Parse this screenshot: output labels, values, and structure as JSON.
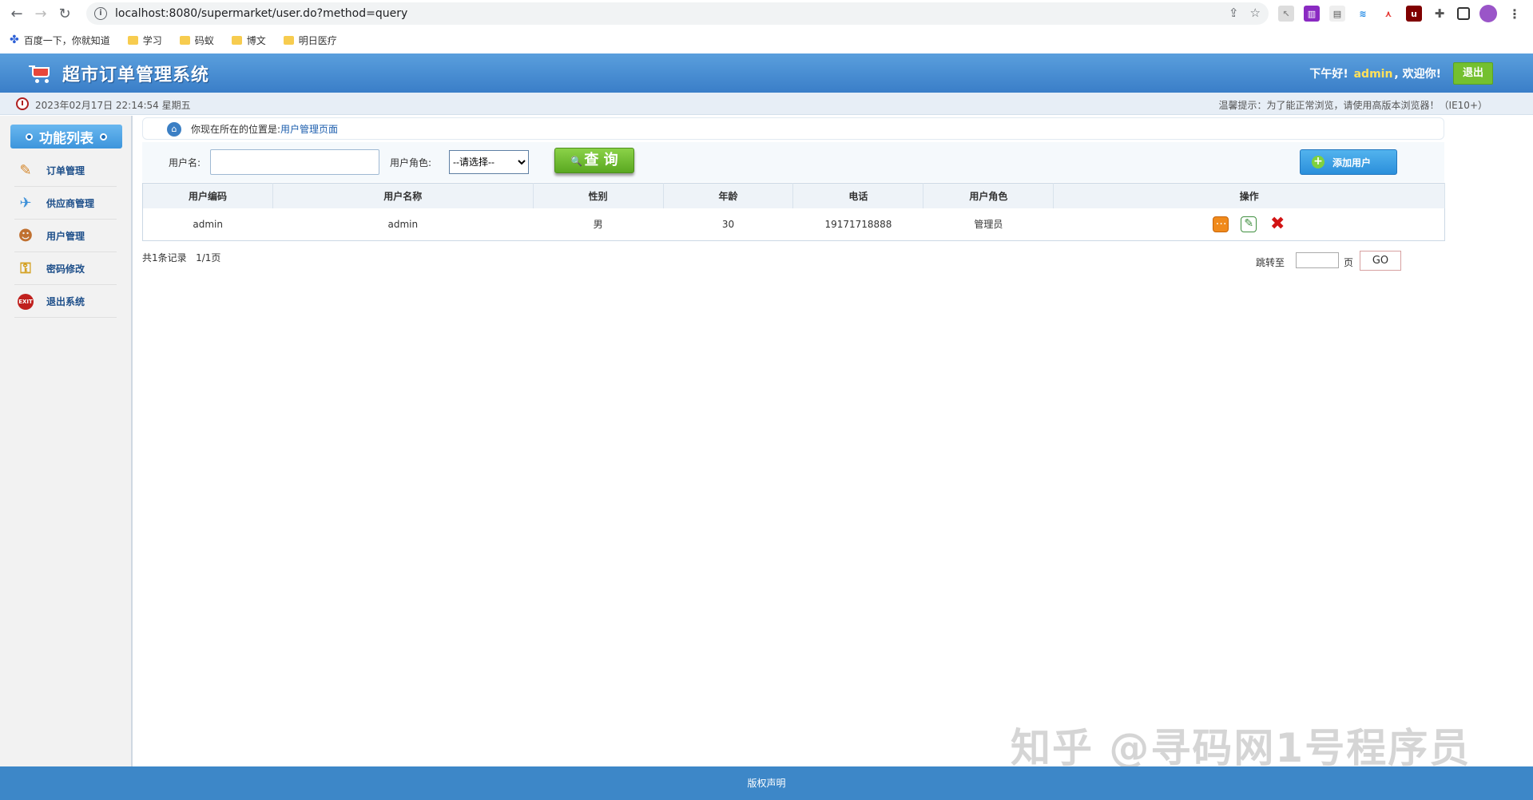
{
  "browser": {
    "url": "localhost:8080/supermarket/user.do?method=query",
    "bookmarks": [
      "百度一下，你就知道",
      "学习",
      "码蚁",
      "博文",
      "明日医疗"
    ]
  },
  "header": {
    "title": "超市订单管理系统",
    "greeting_prefix": "下午好!",
    "username": "admin",
    "greeting_suffix": ", 欢迎你!",
    "logout_label": "退出"
  },
  "info_bar": {
    "datetime": "2023年02月17日 22:14:54 星期五",
    "tip": "温馨提示：为了能正常浏览，请使用高版本浏览器！（IE10+）"
  },
  "sidebar": {
    "title": "功能列表",
    "items": [
      {
        "label": "订单管理",
        "icon": "order-icon"
      },
      {
        "label": "供应商管理",
        "icon": "supplier-icon"
      },
      {
        "label": "用户管理",
        "icon": "users-icon"
      },
      {
        "label": "密码修改",
        "icon": "password-icon"
      },
      {
        "label": "退出系统",
        "icon": "exit-icon"
      }
    ]
  },
  "breadcrumb": {
    "prefix": "你现在所在的位置是:",
    "current": "用户管理页面"
  },
  "search": {
    "username_label": "用户名:",
    "username_value": "",
    "role_label": "用户角色:",
    "role_selected": "--请选择--",
    "query_label": "查 询",
    "add_label": "添加用户"
  },
  "table": {
    "headers": [
      "用户编码",
      "用户名称",
      "性别",
      "年龄",
      "电话",
      "用户角色",
      "操作"
    ],
    "rows": [
      {
        "code": "admin",
        "name": "admin",
        "gender": "男",
        "age": "30",
        "phone": "19171718888",
        "role": "管理员"
      }
    ]
  },
  "pagination": {
    "record_count": "共1条记录",
    "page_info": "1/1页",
    "jump_label": "跳转至",
    "page_unit": "页",
    "go_label": "GO"
  },
  "footer": {
    "copyright": "版权声明"
  },
  "watermark": "知乎 @寻码网1号程序员",
  "colors": {
    "header_blue": "#3a7ec8",
    "accent_green": "#5aa821",
    "footer_blue": "#3d87c8"
  }
}
